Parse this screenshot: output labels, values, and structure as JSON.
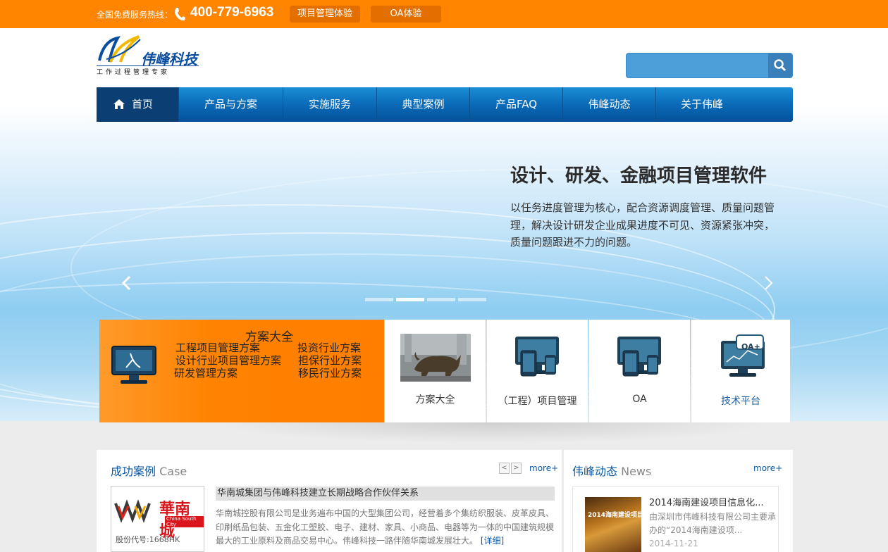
{
  "topbar": {
    "hotline_label": "全国免费服务热线：",
    "phone": "400-779-6963",
    "btn_pm": "项目管理体验",
    "btn_oa": "OA体验"
  },
  "logo": {
    "name": "伟峰科技",
    "slogan": "工作过程管理专家"
  },
  "search": {
    "placeholder": "",
    "value": ""
  },
  "nav": {
    "items": [
      "首页",
      "产品与方案",
      "实施服务",
      "典型案例",
      "产品FAQ",
      "伟峰动态",
      "关于伟峰"
    ],
    "active": 0
  },
  "banner": {
    "title": "设计、研发、金融项目管理软件",
    "text": "以任务进度管理为核心，配合资源调度管理、质量问题管理，解决设计研发企业成果进度不可见、资源紧张冲突，质量问题跟进不力的问题。",
    "dots": 4,
    "active_dot": 1
  },
  "solutions": {
    "title": "方案大全",
    "left": [
      "工程项目管理方案",
      "设计行业项目管理方案",
      "研发管理方案"
    ],
    "right": [
      "投资行业方案",
      "担保行业方案",
      "移民行业方案"
    ]
  },
  "cards": [
    {
      "label": "方案大全",
      "icon": "bull-statue-image"
    },
    {
      "label": "（工程）项目管理",
      "icon": "monitor-devices-icon"
    },
    {
      "label": "OA",
      "icon": "monitor-devices-icon"
    },
    {
      "label": "技术平台",
      "icon": "oa-plus-monitor-icon",
      "badge": "OA+"
    }
  ],
  "cases": {
    "title": "成功案例",
    "title_en": "Case",
    "more": "more+",
    "prev": "<",
    "next": ">",
    "item_title": "华南城集团与伟峰科技建立长期战略合作伙伴关系",
    "item_text": "华南城控股有限公司是业务遍布中国的大型集团公司，经营着多个集纺织服装、皮革皮具、印刷纸品包装、五金化工塑胶、电子、建材、家具、小商品、电器等为一体的中国建筑规模最大的工业原料及商品交易中心。伟峰科技一路伴随华南城发展壮大。",
    "detail": "[详细]",
    "logo_cn": "華南城",
    "logo_en": "China South City",
    "stock": "股份代号:1668HK"
  },
  "news": {
    "title": "伟峰动态",
    "title_en": "News",
    "more": "more+",
    "item_title": "2014海南建设项目信息化...",
    "item_text": "由深圳市伟峰科技有限公司主要承办的“2014海南建设项...",
    "item_date": "2014-11-21",
    "img_caption": "2014海南建设项目"
  },
  "colors": {
    "orange": "#ff8400",
    "nav_blue": "#0a6ab7",
    "link_blue": "#0a5aa6"
  }
}
